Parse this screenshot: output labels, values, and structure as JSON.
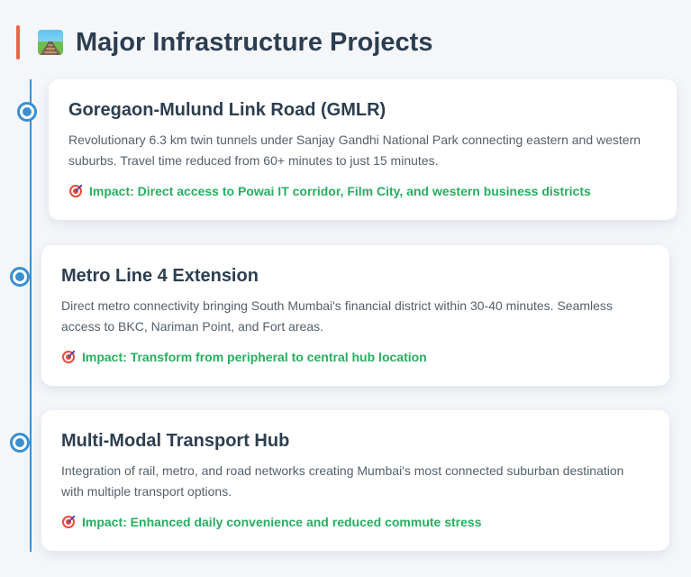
{
  "header": {
    "title": "Major Infrastructure Projects",
    "icon": "railway-track-icon"
  },
  "projects": [
    {
      "title": "Goregaon-Mulund Link Road (GMLR)",
      "description": "Revolutionary 6.3 km twin tunnels under Sanjay Gandhi National Park connecting eastern and western suburbs. Travel time reduced from 60+ minutes to just 15 minutes.",
      "impact": "Impact: Direct access to Powai IT corridor, Film City, and western business districts"
    },
    {
      "title": "Metro Line 4 Extension",
      "description": "Direct metro connectivity bringing South Mumbai's financial district within 30-40 minutes. Seamless access to BKC, Nariman Point, and Fort areas.",
      "impact": "Impact: Transform from peripheral to central hub location"
    },
    {
      "title": "Multi-Modal Transport Hub",
      "description": "Integration of rail, metro, and road networks creating Mumbai's most connected suburban destination with multiple transport options.",
      "impact": "Impact: Enhanced daily convenience and reduced commute stress"
    }
  ],
  "colors": {
    "accent": "#e8674a",
    "timeline": "#3a8fd0",
    "impact": "#27ae60",
    "title": "#2c3e50"
  }
}
